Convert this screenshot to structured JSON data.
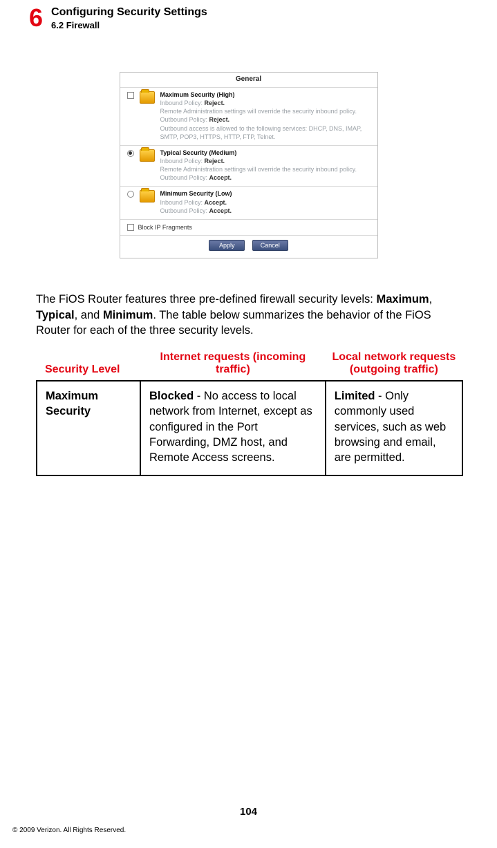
{
  "header": {
    "chapter_number": "6",
    "title": "Configuring Security Settings",
    "subsection": "6.2  Firewall"
  },
  "panel": {
    "tab": "General",
    "options": [
      {
        "title": "Maximum Security (High)",
        "l1a": "Inbound Policy: ",
        "l1b": "Reject.",
        "l2": "Remote Administration settings will override the security inbound policy.",
        "l3a": "Outbound Policy: ",
        "l3b": "Reject.",
        "l4": "Outbound access is allowed to the following services: DHCP, DNS, IMAP, SMTP, POP3, HTTPS, HTTP, FTP, Telnet."
      },
      {
        "title": "Typical Security (Medium)",
        "l1a": "Inbound Policy: ",
        "l1b": "Reject.",
        "l2": "Remote Administration settings will override the security inbound policy.",
        "l3a": "Outbound Policy: ",
        "l3b": "Accept."
      },
      {
        "title": "Minimum Security (Low)",
        "l1a": "Inbound Policy: ",
        "l1b": "Accept.",
        "l3a": "Outbound Policy: ",
        "l3b": "Accept."
      }
    ],
    "block_ip": "Block IP Fragments",
    "apply": "Apply",
    "cancel": "Cancel"
  },
  "paragraph": {
    "p1": "The FiOS Router features three pre-defined firewall security levels: ",
    "b1": "Maximum",
    "p2": ", ",
    "b2": "Typical",
    "p3": ", and ",
    "b3": "Minimum",
    "p4": ". The table below summarizes the behavior of the FiOS Router for each of the three security levels."
  },
  "table": {
    "h1": "Security Level",
    "h2": "Internet requests (incoming traffic)",
    "h3": "Local network requests (outgoing traffic)",
    "row": {
      "level": "Maximum Security",
      "in_b": "Blocked",
      "in_t1": " - No access to local network from Internet, except as configured in the Port Forwarding, ",
      "in_sc": "DMZ",
      "in_t2": " host, and Remote Access screens.",
      "out_b": "Limited",
      "out_t": " - Only commonly used services, such as web browsing and email, are permitted."
    }
  },
  "page_number": "104",
  "copyright": "© 2009 Verizon. All Rights Reserved."
}
